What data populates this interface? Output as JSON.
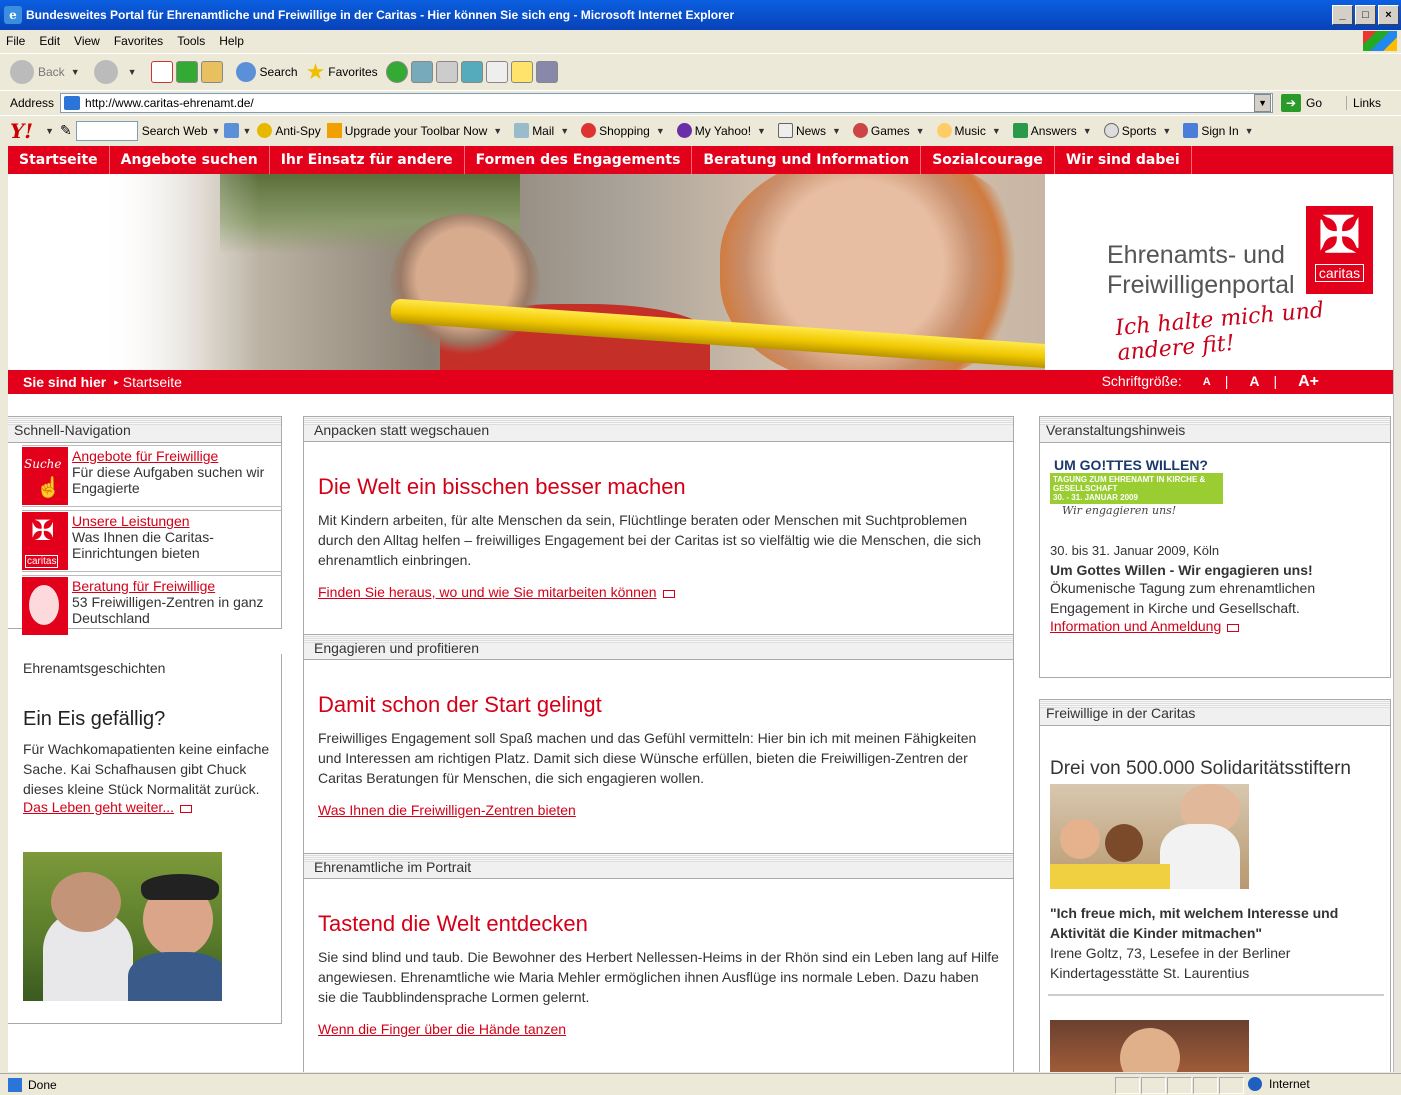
{
  "window": {
    "title": "Bundesweites Portal für Ehrenamtliche und Freiwillige in der Caritas - Hier können Sie sich eng - Microsoft Internet Explorer",
    "controls": [
      "_",
      "□",
      "×"
    ]
  },
  "menubar": [
    "File",
    "Edit",
    "View",
    "Favorites",
    "Tools",
    "Help"
  ],
  "toolbar": {
    "back": "Back",
    "search": "Search",
    "favorites": "Favorites"
  },
  "address": {
    "label": "Address",
    "url": "http://www.caritas-ehrenamt.de/",
    "go": "Go",
    "links": "Links"
  },
  "yahoo": {
    "logo": "Y!",
    "search_web": "Search Web",
    "items": [
      "Anti-Spy",
      "Upgrade your Toolbar Now",
      "Mail",
      "Shopping",
      "My Yahoo!",
      "News",
      "Games",
      "Music",
      "Answers",
      "Sports",
      "Sign In"
    ]
  },
  "nav": [
    "Startseite",
    "Angebote suchen",
    "Ihr Einsatz für andere",
    "Formen des Engagements",
    "Beratung und Information",
    "Sozialcourage",
    "Wir sind dabei"
  ],
  "hero": {
    "title_line1": "Ehrenamts- und",
    "title_line2": "Freiwilligenportal",
    "logo_text": "caritas",
    "slogan": "Ich halte mich und andere fit!"
  },
  "breadcrumb": {
    "label": "Sie sind hier",
    "current": "Startseite",
    "fontsize_label": "Schriftgröße:",
    "fs_small": "A",
    "fs_mid": "A",
    "fs_big": "A+"
  },
  "left": {
    "quicknav_title": "Schnell-Navigation",
    "items": [
      {
        "link": "Angebote für Freiwillige",
        "text": "Für diese Aufgaben suchen wir Engagierte",
        "img_label": "Suche"
      },
      {
        "link": "Unsere Leistungen",
        "text": "Was Ihnen die Caritas-Einrichtungen bieten",
        "img_label": "caritas"
      },
      {
        "link": "Beratung für Freiwillige",
        "text": "53 Freiwilligen-Zentren in ganz Deutschland",
        "img_label": ""
      }
    ],
    "stories_title": "Ehrenamtsgeschichten",
    "story_heading": "Ein Eis gefällig?",
    "story_text": "Für Wachkomapatienten keine einfache Sache. Kai Schafhausen gibt Chuck dieses kleine Stück Normalität zurück.",
    "story_link": "Das Leben geht weiter..."
  },
  "center": {
    "sections": [
      {
        "head": "Anpacken statt wegschauen",
        "title": "Die Welt ein bisschen besser machen",
        "text": "Mit Kindern arbeiten, für alte Menschen da sein, Flüchtlinge beraten oder Menschen mit Suchtproblemen durch den Alltag helfen – freiwilliges Engagement bei der Caritas ist so vielfältig wie die Menschen, die sich ehrenamtlich einbringen.",
        "link": "Finden Sie heraus, wo und wie Sie mitarbeiten können"
      },
      {
        "head": "Engagieren und profitieren",
        "title": "Damit schon der Start gelingt",
        "text": "Freiwilliges Engagement soll Spaß machen und das Gefühl vermitteln: Hier bin ich mit meinen Fähigkeiten und Interessen am richtigen Platz. Damit sich diese Wünsche erfüllen, bieten die Freiwilligen-Zentren der Caritas Beratungen für Menschen, die sich engagieren wollen.",
        "link": "Was Ihnen die Freiwilligen-Zentren bieten"
      },
      {
        "head": "Ehrenamtliche im Portrait",
        "title": "Tastend die Welt entdecken",
        "text": "Sie sind blind und taub. Die Bewohner des Herbert Nellessen-Heims in der Rhön sind ein Leben lang auf Hilfe angewiesen. Ehrenamtliche wie Maria Mehler ermöglichen ihnen Ausflüge ins normale Leben. Dazu haben sie die Taubblindensprache Lormen gelernt.",
        "link": "Wenn die Finger über die Hände tanzen"
      }
    ]
  },
  "right": {
    "event_title": "Veranstaltungshinweis",
    "event_logo_l1": "UM GO!TTES WILLEN?",
    "event_logo_l2": "TAGUNG ZUM EHRENAMT IN KIRCHE & GESELLSCHAFT",
    "event_logo_l3": "30. - 31. JANUAR 2009",
    "event_logo_l4": "Wir engagieren uns!",
    "event_date": "30. bis 31. Januar 2009, Köln",
    "event_heading": "Um Gottes Willen - Wir engagieren uns!",
    "event_text": "Ökumenische Tagung zum ehrenamtlichen Engagement in Kirche und Gesellschaft.",
    "event_link": "Information und Anmeldung",
    "vol_title": "Freiwillige in der Caritas",
    "vol_heading": "Drei von 500.000 Solidaritätsstiftern",
    "vol_quote": "\"Ich freue mich, mit welchem Interesse und Aktivität die Kinder mitmachen\"",
    "vol_person": "Irene Goltz, 73, Lesefee in der Berliner Kindertagesstätte St. Laurentius"
  },
  "status": {
    "text": "Done",
    "zone": "Internet"
  },
  "colors": {
    "caritas_red": "#e2001a",
    "link_red": "#d40018"
  }
}
